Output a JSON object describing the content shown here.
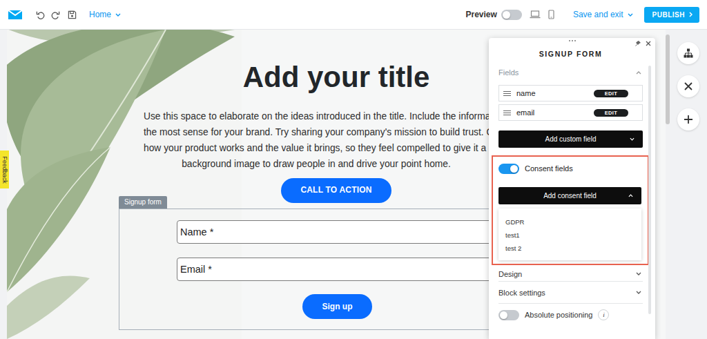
{
  "toolbar": {
    "page": "Home",
    "preview": {
      "label": "Preview",
      "on": false
    },
    "save_exit": "Save and exit",
    "publish": "PUBLISH"
  },
  "feedback": "Feedback",
  "page": {
    "title": "Add your title",
    "paragraph": [
      "Use this space to elaborate on the ideas introduced in the title. Include the information th",
      "the most sense for your brand. Try sharing your company's mission to build trust. Or, brie",
      "how your product works and the value it brings, so they feel compelled to give it a go. Cus",
      "background image to draw people in and drive your point home."
    ],
    "cta": "CALL TO ACTION",
    "form": {
      "tab": "Signup form",
      "fields": [
        "Name *",
        "Email *"
      ],
      "submit": "Sign up"
    }
  },
  "panel": {
    "title": "SIGNUP FORM",
    "fields_section": {
      "label": "Fields",
      "expanded": true
    },
    "fields": [
      {
        "name": "name",
        "button": "EDIT"
      },
      {
        "name": "email",
        "button": "EDIT"
      }
    ],
    "add_custom_field": {
      "label": "Add custom field",
      "expanded": false
    },
    "consent": {
      "label": "Consent fields",
      "on": true,
      "add_button": {
        "label": "Add consent field",
        "expanded": true
      },
      "options": [
        "GDPR",
        "test1",
        "test 2"
      ]
    },
    "sections": [
      {
        "label": "Design",
        "expanded": false
      },
      {
        "label": "Block settings",
        "expanded": false
      }
    ],
    "absolute_positioning": {
      "label": "Absolute positioning",
      "on": false,
      "info": "i"
    }
  }
}
